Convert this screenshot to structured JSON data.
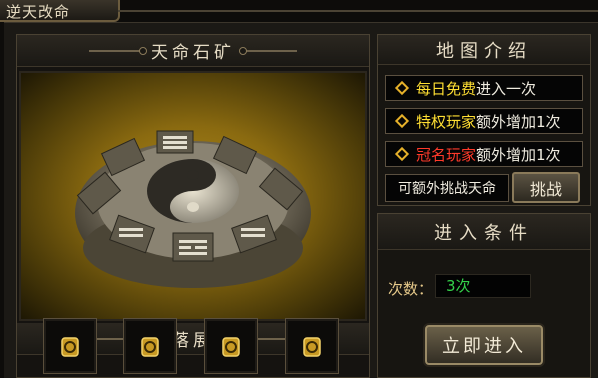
{
  "window": {
    "title": "逆天改命"
  },
  "map_panel": {
    "title": "天命石矿",
    "scene_icon": "bagua-stone-ring",
    "drops_title": "掉落展示",
    "drops": [
      {
        "icon": "gold-scroll-gem"
      },
      {
        "icon": "gold-scroll-gem"
      },
      {
        "icon": "gold-scroll-gem"
      },
      {
        "icon": "gold-scroll-gem"
      }
    ]
  },
  "intro_panel": {
    "title": "地图介绍",
    "rows": [
      {
        "highlight": "每日免费",
        "rest": "进入一次",
        "highlight_color": "#ffdf33"
      },
      {
        "highlight": "特权玩家",
        "rest": "额外增加1次",
        "highlight_color": "#ffdf33"
      },
      {
        "highlight": "冠名玩家",
        "rest": "额外增加1次",
        "highlight_color": "#ff3a2a"
      }
    ],
    "extra_text": "可额外挑战天命",
    "challenge_label": "挑战"
  },
  "condition_panel": {
    "title": "进入条件",
    "count_label": "次数：",
    "count_value": "3次",
    "enter_label": "立即进入"
  }
}
